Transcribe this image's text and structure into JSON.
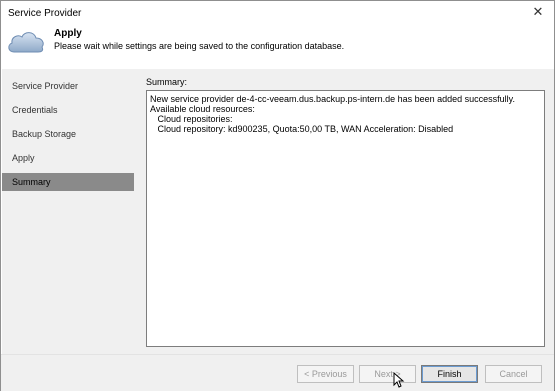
{
  "window": {
    "title": "Service Provider",
    "close_icon": "close-icon"
  },
  "header": {
    "icon": "cloud-icon",
    "title": "Apply",
    "subtitle": "Please wait while settings are being saved to the configuration database."
  },
  "sidebar": {
    "items": [
      {
        "label": "Service Provider"
      },
      {
        "label": "Credentials"
      },
      {
        "label": "Backup Storage"
      },
      {
        "label": "Apply"
      },
      {
        "label": "Summary",
        "active": true
      }
    ]
  },
  "main": {
    "summary_label": "Summary:",
    "summary_text": "New service provider de-4-cc-veeam.dus.backup.ps-intern.de has been added successfully.\nAvailable cloud resources:\n   Cloud repositories:\n   Cloud repository: kd900235, Quota:50,00 TB, WAN Acceleration: Disabled"
  },
  "footer": {
    "previous_label": "< Previous",
    "next_label": "Next >",
    "finish_label": "Finish",
    "cancel_label": "Cancel"
  },
  "colors": {
    "active_item_bg": "#8a8a8a",
    "panel_bg": "#f0f0f0",
    "focus_border": "#6b9bd1"
  }
}
